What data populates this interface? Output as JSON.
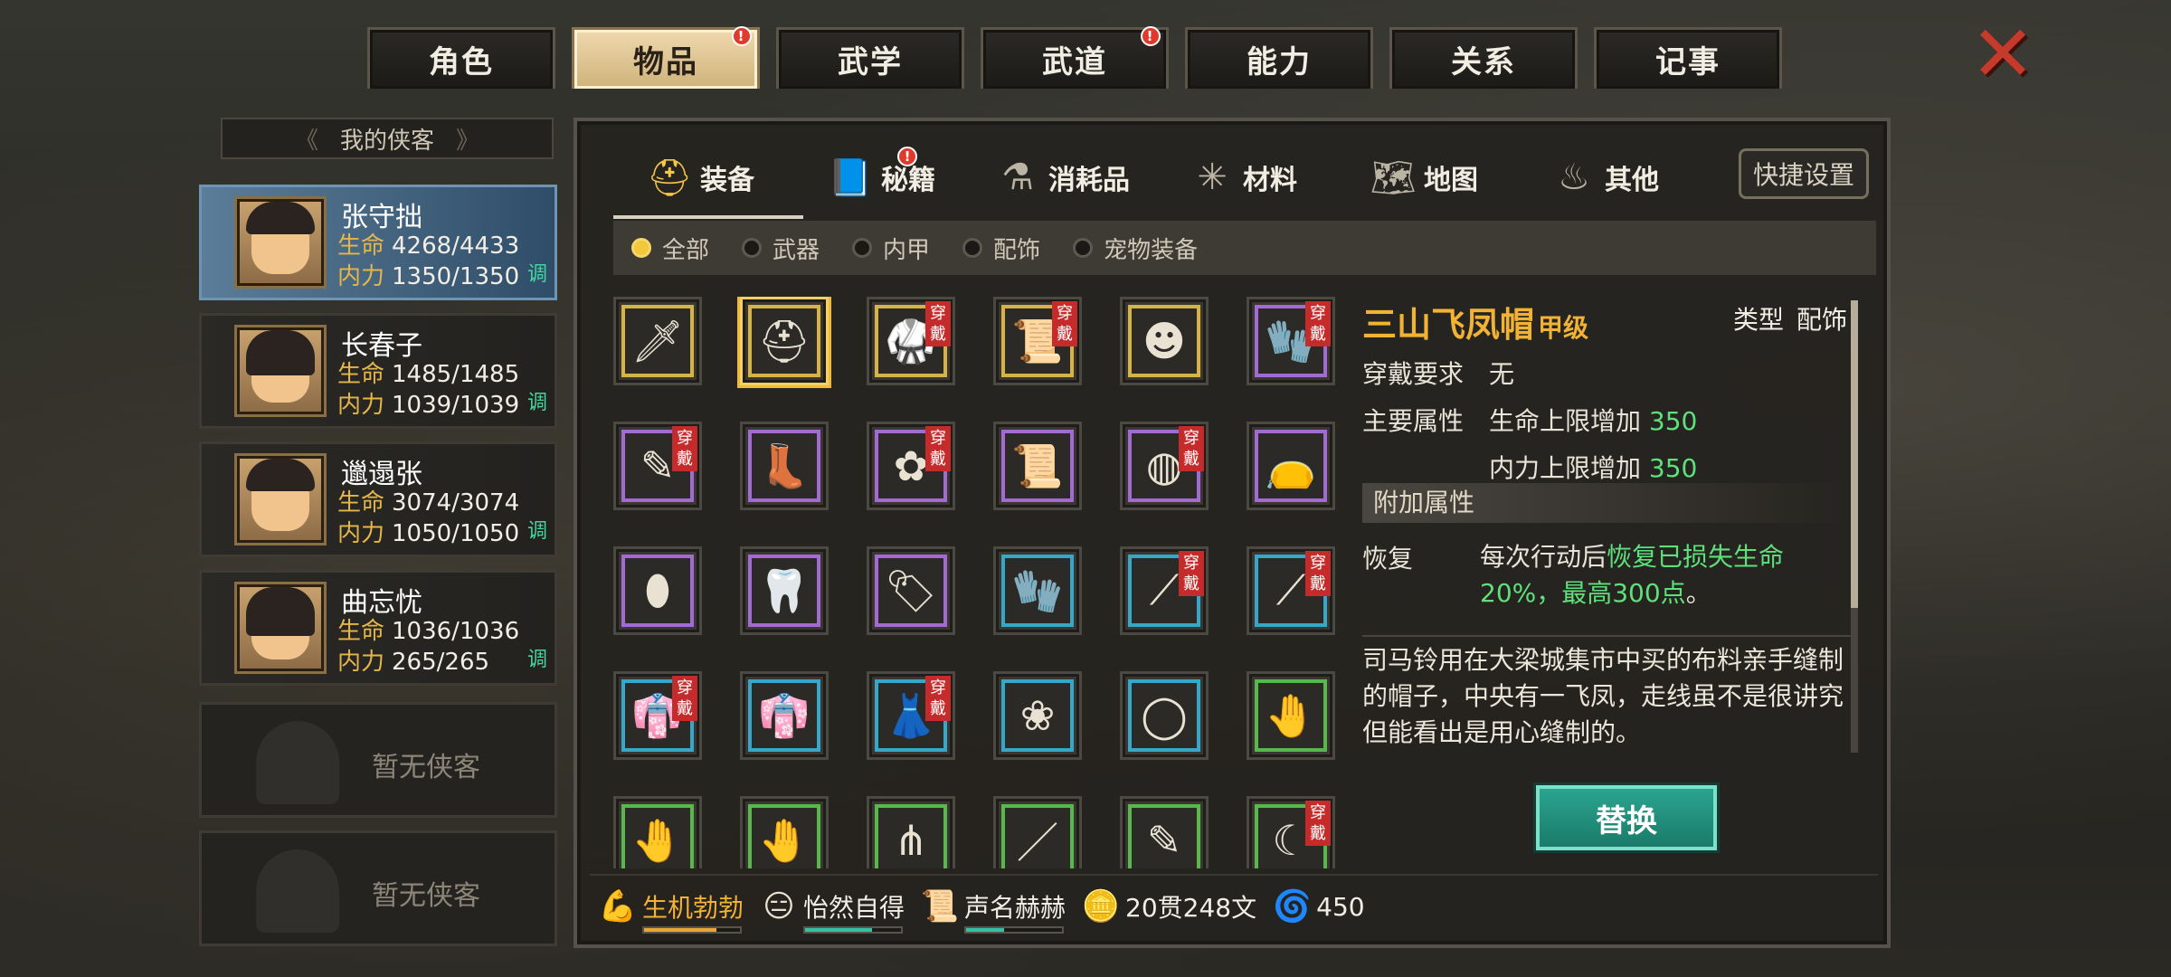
{
  "top_tabs": [
    {
      "label": "角色",
      "active": false,
      "badge": false
    },
    {
      "label": "物品",
      "active": true,
      "badge": true
    },
    {
      "label": "武学",
      "active": false,
      "badge": false
    },
    {
      "label": "武道",
      "active": false,
      "badge": true
    },
    {
      "label": "能力",
      "active": false,
      "badge": false
    },
    {
      "label": "关系",
      "active": false,
      "badge": false
    },
    {
      "label": "记事",
      "active": false,
      "badge": false
    }
  ],
  "badge_mark": "!",
  "close_icon": "✕",
  "left": {
    "header": "我的侠客",
    "heroes": [
      {
        "name": "张守拙",
        "hp_label": "生命",
        "hp": "4268/4433",
        "mp_label": "内力",
        "mp": "1350/1350",
        "tiao": "调",
        "selected": true
      },
      {
        "name": "长春子",
        "hp_label": "生命",
        "hp": "1485/1485",
        "mp_label": "内力",
        "mp": "1039/1039",
        "tiao": "调",
        "selected": false
      },
      {
        "name": "邋遢张",
        "hp_label": "生命",
        "hp": "3074/3074",
        "mp_label": "内力",
        "mp": "1050/1050",
        "tiao": "调",
        "selected": false
      },
      {
        "name": "曲忘忧",
        "hp_label": "生命",
        "hp": "1036/1036",
        "mp_label": "内力",
        "mp": "265/265",
        "tiao": "调",
        "selected": false
      }
    ],
    "empty_label": "暂无侠客"
  },
  "categories": [
    {
      "label": "装备",
      "icon": "helmet-icon",
      "glyph": "⛑",
      "active": true,
      "badge": false
    },
    {
      "label": "秘籍",
      "icon": "book-icon",
      "glyph": "📘",
      "active": false,
      "badge": true
    },
    {
      "label": "消耗品",
      "icon": "potion-icon",
      "glyph": "⚗",
      "active": false,
      "badge": false
    },
    {
      "label": "材料",
      "icon": "herb-icon",
      "glyph": "✳",
      "active": false,
      "badge": false
    },
    {
      "label": "地图",
      "icon": "map-icon",
      "glyph": "🗺",
      "active": false,
      "badge": false
    },
    {
      "label": "其他",
      "icon": "lamp-icon",
      "glyph": "♨",
      "active": false,
      "badge": false
    }
  ],
  "quick_settings": "快捷设置",
  "filters": [
    {
      "label": "全部",
      "on": true
    },
    {
      "label": "武器",
      "on": false
    },
    {
      "label": "内甲",
      "on": false
    },
    {
      "label": "配饰",
      "on": false
    },
    {
      "label": "宠物装备",
      "on": false
    }
  ],
  "worn_text": [
    "穿",
    "戴"
  ],
  "items": [
    {
      "icon": "sword-icon",
      "glyph": "🗡",
      "color": "#d7b244",
      "worn": false
    },
    {
      "icon": "helmet-icon",
      "glyph": "⛑",
      "color": "#d7b244",
      "worn": false,
      "selected": true
    },
    {
      "icon": "armor-icon",
      "glyph": "🥋",
      "color": "#d7b244",
      "worn": true
    },
    {
      "icon": "amulet-icon",
      "glyph": "📜",
      "color": "#d7b244",
      "worn": true
    },
    {
      "icon": "mask-icon",
      "glyph": "☻",
      "color": "#d7b244",
      "worn": false
    },
    {
      "icon": "bracer-icon",
      "glyph": "🧤",
      "color": "#a46ad4",
      "worn": true
    },
    {
      "icon": "brush-icon",
      "glyph": "✎",
      "color": "#a46ad4",
      "worn": true
    },
    {
      "icon": "boots-icon",
      "glyph": "👢",
      "color": "#a46ad4",
      "worn": false
    },
    {
      "icon": "pendant-icon",
      "glyph": "✿",
      "color": "#a46ad4",
      "worn": true
    },
    {
      "icon": "scroll-icon",
      "glyph": "📜",
      "color": "#a46ad4",
      "worn": false
    },
    {
      "icon": "orb-icon",
      "glyph": "◍",
      "color": "#a46ad4",
      "worn": true
    },
    {
      "icon": "pouch-icon",
      "glyph": "👝",
      "color": "#a46ad4",
      "worn": false
    },
    {
      "icon": "hat-icon",
      "glyph": "⬮",
      "color": "#a46ad4",
      "worn": false
    },
    {
      "icon": "fang-icon",
      "glyph": "🦷",
      "color": "#a46ad4",
      "worn": false
    },
    {
      "icon": "talisman-icon",
      "glyph": "🏷",
      "color": "#a46ad4",
      "worn": false
    },
    {
      "icon": "gauntlet-icon",
      "glyph": "🧤",
      "color": "#36a7c8",
      "worn": false
    },
    {
      "icon": "spear-icon",
      "glyph": "⟋",
      "color": "#36a7c8",
      "worn": true
    },
    {
      "icon": "spear-icon",
      "glyph": "⟋",
      "color": "#36a7c8",
      "worn": true
    },
    {
      "icon": "robe-icon",
      "glyph": "👘",
      "color": "#36a7c8",
      "worn": true
    },
    {
      "icon": "robe-icon",
      "glyph": "👘",
      "color": "#36a7c8",
      "worn": false
    },
    {
      "icon": "dress-icon",
      "glyph": "👗",
      "color": "#36a7c8",
      "worn": true
    },
    {
      "icon": "flower-icon",
      "glyph": "❀",
      "color": "#36a7c8",
      "worn": false
    },
    {
      "icon": "jade-ring-icon",
      "glyph": "◯",
      "color": "#36a7c8",
      "worn": false
    },
    {
      "icon": "bandage-icon",
      "glyph": "🤚",
      "color": "#57b84b",
      "worn": false
    },
    {
      "icon": "bandage-icon",
      "glyph": "🤚",
      "color": "#57b84b",
      "worn": false
    },
    {
      "icon": "bandage-icon",
      "glyph": "🤚",
      "color": "#57b84b",
      "worn": false
    },
    {
      "icon": "fork-icon",
      "glyph": "⋔",
      "color": "#57b84b",
      "worn": false
    },
    {
      "icon": "staff-icon",
      "glyph": "／",
      "color": "#57b84b",
      "worn": false
    },
    {
      "icon": "brush-icon",
      "glyph": "✎",
      "color": "#57b84b",
      "worn": false
    },
    {
      "icon": "scythe-icon",
      "glyph": "☾",
      "color": "#57b84b",
      "worn": true
    }
  ],
  "detail": {
    "name": "三山飞凤帽",
    "grade": "甲级",
    "type_label": "类型",
    "type_value": "配饰",
    "req_label": "穿戴要求",
    "req_value": "无",
    "main_label": "主要属性",
    "attr1_name": "生命上限增加",
    "attr1_value": "350",
    "attr2_name": "内力上限增加",
    "attr2_value": "350",
    "extra_label": "附加属性",
    "recover_label": "恢复",
    "recover_prefix": "每次行动后",
    "recover_green": "恢复已损失生命20%，最高300点",
    "recover_suffix": "。",
    "description": "司马铃用在大梁城集市中买的布料亲手缝制的帽子，中央有一飞凤，走线虽不是很讲究但能看出是用心缝制的。",
    "replace_button": "替换"
  },
  "status": [
    {
      "icon": "strength-icon",
      "glyph": "💪",
      "label": "生机勃勃",
      "color": "#f2b335",
      "bar_color": "#e9a833",
      "fill": 0.75
    },
    {
      "icon": "calm-face-icon",
      "glyph": "😑",
      "label": "怡然自得",
      "color": "#f2eee6",
      "bar_color": "#35c2a4",
      "fill": 0.7
    },
    {
      "icon": "reputation-icon",
      "glyph": "📜",
      "label": "声名赫赫",
      "color": "#f2eee6",
      "bar_color": "#35c2a4",
      "fill": 0.4
    },
    {
      "icon": "coin-icon",
      "glyph": "🪙",
      "label": "20贯248文",
      "color": "#f2eee6"
    },
    {
      "icon": "jade-icon",
      "glyph": "🌀",
      "label": "450",
      "color": "#f2eee6"
    }
  ]
}
